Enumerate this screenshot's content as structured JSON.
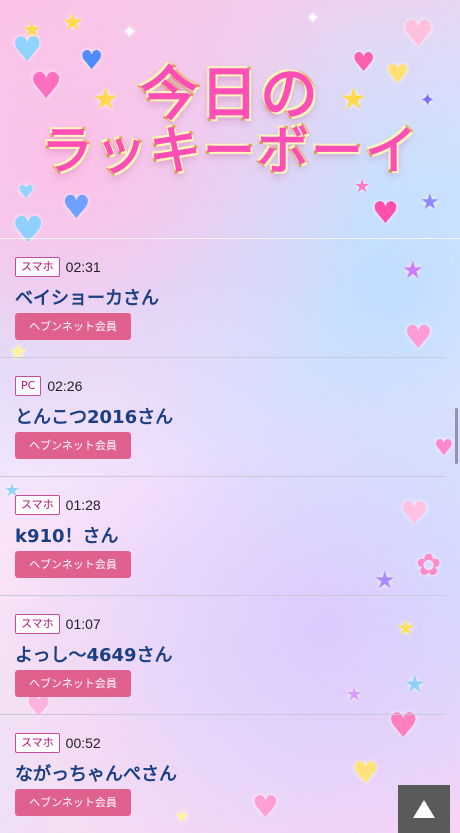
{
  "header": {
    "title_line1": "今日の",
    "title_line2": "ラッキーボーイ"
  },
  "colors": {
    "title_fill": "#ff4fb4",
    "title_outline": "#d9a21b",
    "device_badge_border": "#c64d9c",
    "user_name": "#1b3f82",
    "member_badge_bg": "#e0618e",
    "top_button_bg": "#5a5a5a"
  },
  "entries": [
    {
      "device": "スマホ",
      "time": "02:31",
      "name": "ベイショーカさん",
      "member": "ヘブンネット会員"
    },
    {
      "device": "PC",
      "time": "02:26",
      "name": "とんこつ2016さん",
      "member": "ヘブンネット会員"
    },
    {
      "device": "スマホ",
      "time": "01:28",
      "name": "k910！さん",
      "member": "ヘブンネット会員"
    },
    {
      "device": "スマホ",
      "time": "01:07",
      "name": "よっし〜4649さん",
      "member": "ヘブンネット会員"
    },
    {
      "device": "スマホ",
      "time": "00:52",
      "name": "ながっちゃんぺさん",
      "member": "ヘブンネット会員"
    }
  ],
  "scroll_top_button": {
    "icon": "triangle-up-icon"
  }
}
